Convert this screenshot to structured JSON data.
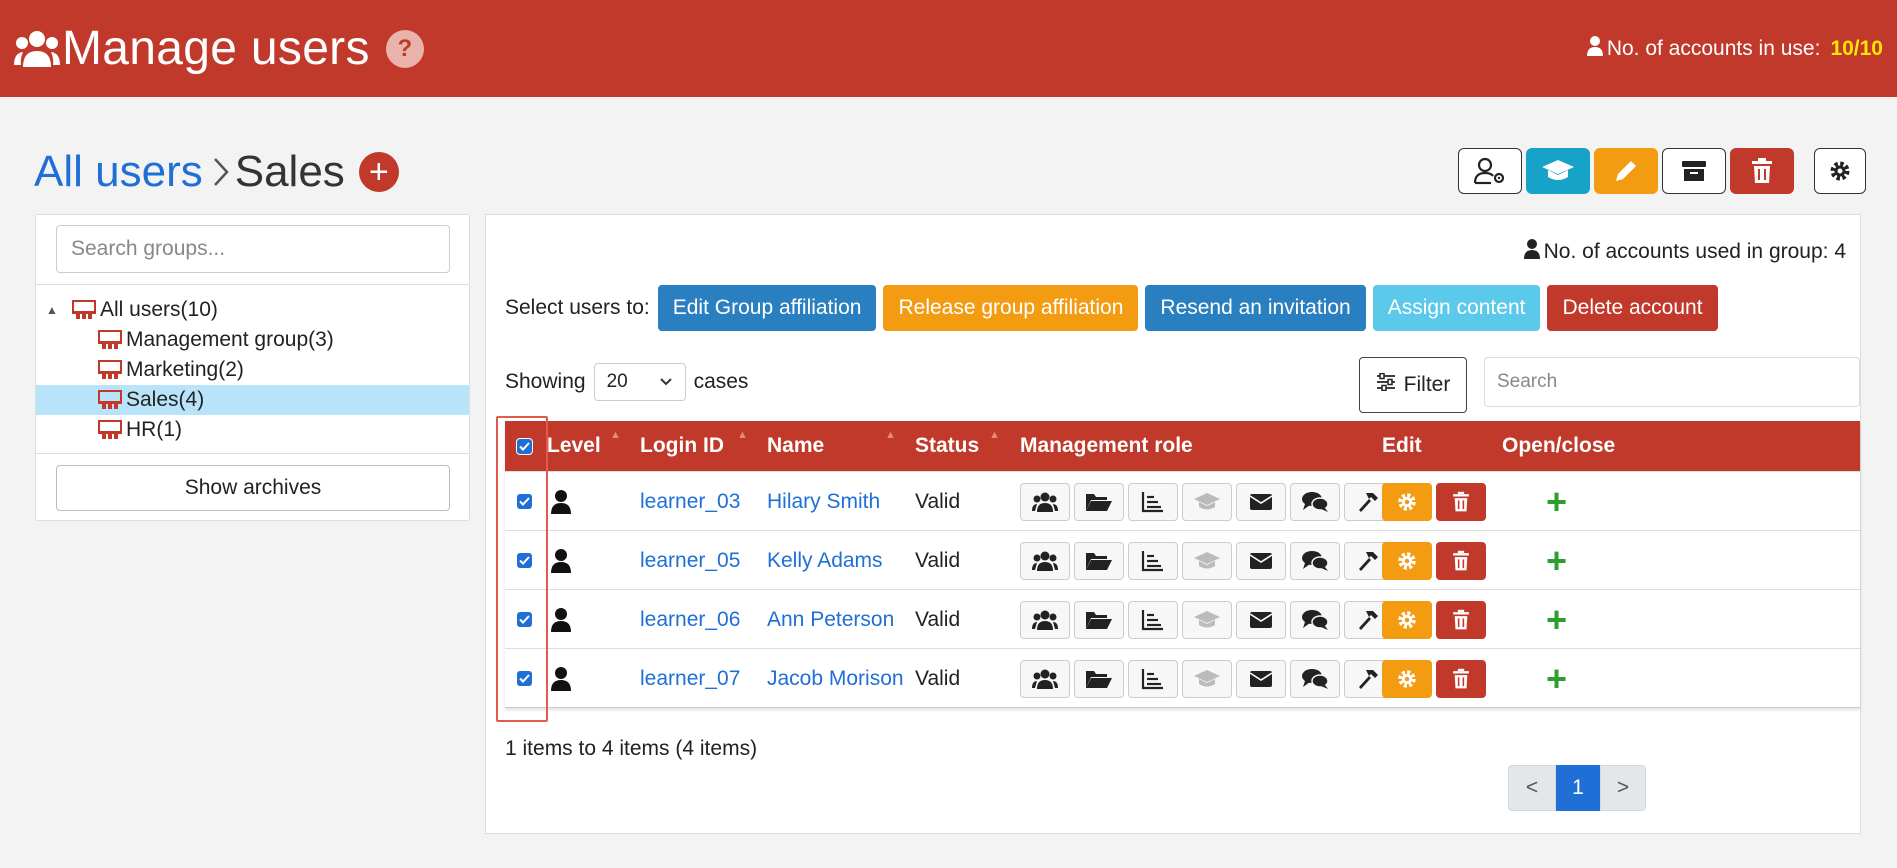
{
  "header": {
    "title": "Manage users",
    "help_label": "?",
    "accounts_label": "No. of accounts in use:",
    "accounts_value": "10/10"
  },
  "breadcrumb": {
    "root": "All users",
    "current": "Sales",
    "add_label": "+"
  },
  "sidebar": {
    "search_placeholder": "Search groups...",
    "tree": [
      {
        "label": "All users(10)",
        "level": 0,
        "selected": false
      },
      {
        "label": "Management group(3)",
        "level": 1,
        "selected": false
      },
      {
        "label": "Marketing(2)",
        "level": 1,
        "selected": false
      },
      {
        "label": "Sales(4)",
        "level": 1,
        "selected": true
      },
      {
        "label": "HR(1)",
        "level": 1,
        "selected": false
      }
    ],
    "show_archives": "Show archives"
  },
  "main": {
    "group_accounts_label": "No. of accounts used in group: 4",
    "select_users_label": "Select users to:",
    "actions": {
      "edit_group": "Edit Group affiliation",
      "release_group": "Release group affiliation",
      "resend": "Resend an invitation",
      "assign": "Assign content",
      "delete": "Delete account"
    },
    "showing_label": "Showing",
    "page_size": "20",
    "cases_label": "cases",
    "filter_label": "Filter",
    "search_placeholder": "Search",
    "columns": {
      "level": "Level",
      "login": "Login ID",
      "name": "Name",
      "status": "Status",
      "role": "Management role",
      "edit": "Edit",
      "open": "Open/close"
    },
    "rows": [
      {
        "login": "learner_03",
        "name": "Hilary Smith",
        "status": "Valid",
        "open": "+"
      },
      {
        "login": "learner_05",
        "name": "Kelly Adams",
        "status": "Valid",
        "open": "+"
      },
      {
        "login": "learner_06",
        "name": "Ann Peterson",
        "status": "Valid",
        "open": "+"
      },
      {
        "login": "learner_07",
        "name": "Jacob Morison",
        "status": "Valid",
        "open": "+"
      }
    ],
    "items_info": "1 items to 4 items (4 items)",
    "pager": {
      "prev": "<",
      "current": "1",
      "next": ">"
    }
  },
  "colors": {
    "header_red": "#c0392b",
    "accent_blue": "#1f6fd6",
    "orange": "#f39c12",
    "cyan": "#17a2c8",
    "accounts_value_yellow": "#ffe600"
  }
}
